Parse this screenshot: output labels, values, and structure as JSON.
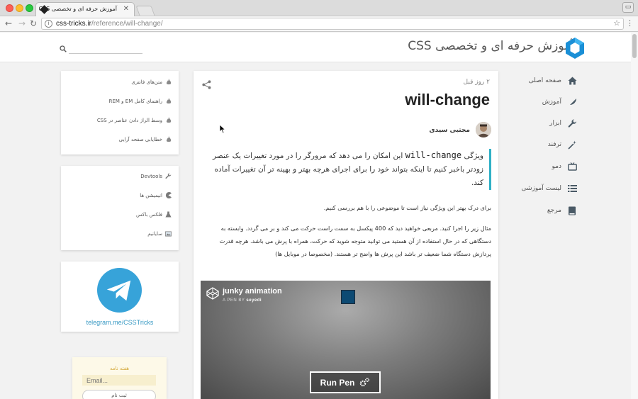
{
  "browser": {
    "tab_title": "آموزش حرفه ای و تخصصی CSS",
    "tab_close": "✕",
    "url_domain": "css-tricks.ir",
    "url_path": "/reference/will-change/"
  },
  "header": {
    "site_title": "آموزش حرفه ای و تخصصی CSS",
    "search_placeholder": ""
  },
  "nav": {
    "items": [
      {
        "label": "صفحه اصلی",
        "icon": "home-icon"
      },
      {
        "label": "آموزش",
        "icon": "feather-icon"
      },
      {
        "label": "ابزار",
        "icon": "wrench-icon"
      },
      {
        "label": "ترفند",
        "icon": "magic-wand-icon"
      },
      {
        "label": "دمو",
        "icon": "tv-icon"
      },
      {
        "label": "لیست آموزشی",
        "icon": "list-icon"
      },
      {
        "label": "مرجع",
        "icon": "book-icon"
      }
    ]
  },
  "article": {
    "date": "۲ روز قبل",
    "title": "will-change",
    "author": "مجتبی سیدی",
    "lead_prefix": "ویژگی",
    "lead_code": "will-change",
    "lead_suffix": "این امکان را می دهد که مرورگر را در مورد تغییرات یک عنصر زودتر باخبر کنیم تا اینکه بتواند خود را برای اجرای هرچه بهتر و بهینه تر آن تغییرات آماده کند.",
    "para1": "برای درک بهتر این ویژگی نیاز است تا موضوعی را با هم بررسی کنیم.",
    "para2": "مثال زیر را اجرا کنید. مربعی خواهید دید که 400 پیکسل به سمت راست حرکت می کند و بر می گردد. وابسته به دستگاهی که در حال استفاده از آن هستید می توانید متوجه شوید که حرکت، همراه با پرش می باشد. هرچه قدرت پردازش دستگاه شما ضعیف تر باشد این پرش ها واضح تر هستند. (مخصوصا در موبایل ها)",
    "codepen": {
      "title": "junky animation",
      "byline_prefix": "A PEN BY",
      "byline_author": "seyedi",
      "run_label": "Run Pen"
    }
  },
  "widgets": {
    "popular": [
      {
        "label": "متن‌های فانتزی"
      },
      {
        "label": "راهنمای کامل EM و REM"
      },
      {
        "label": "وسط الراز دادن عناصر در CSS"
      },
      {
        "label": "خطایابی صفحه آرایی"
      }
    ],
    "tools": [
      {
        "label": "Devtools",
        "icon": "wrench-icon"
      },
      {
        "label": "انیمیشن ها",
        "icon": "pacman-icon"
      },
      {
        "label": "فلکس باکس",
        "icon": "flask-icon"
      },
      {
        "label": "سایانیم",
        "icon": "image-icon"
      }
    ],
    "telegram_link": "telegram.me/CSSTricks"
  },
  "newsletter": {
    "title": "هفته نامه",
    "email_placeholder": "Email...",
    "submit_label": "ثبت نام"
  },
  "colors": {
    "accent": "#2fb0c6",
    "telegram": "#37a3d9",
    "logo": "#1a8fd6"
  }
}
